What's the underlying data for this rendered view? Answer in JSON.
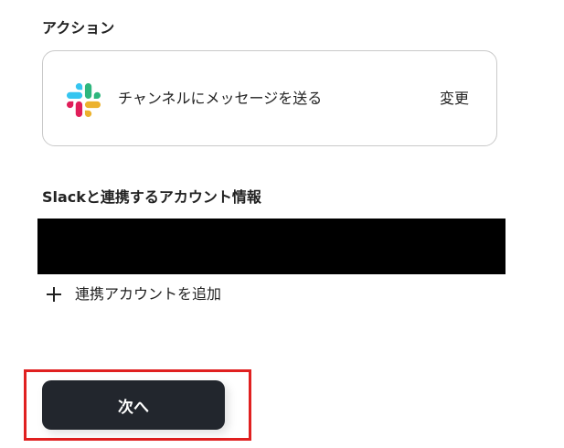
{
  "action_section": {
    "label": "アクション",
    "card": {
      "icon": "slack-logo-icon",
      "action_name": "チャンネルにメッセージを送る",
      "change_label": "変更"
    }
  },
  "account_section": {
    "label": "Slackと連携するアカウント情報",
    "add_account_icon": "plus-icon",
    "add_account_label": "連携アカウントを追加"
  },
  "footer": {
    "next_button_label": "次へ"
  },
  "colors": {
    "button_bg": "#22262d",
    "highlight": "#e02020",
    "card_border": "#c9c9c9",
    "redacted": "#000000",
    "slack_blue": "#36C5F0",
    "slack_green": "#2EB67D",
    "slack_yellow": "#ECB22E",
    "slack_red": "#E01E5A"
  }
}
